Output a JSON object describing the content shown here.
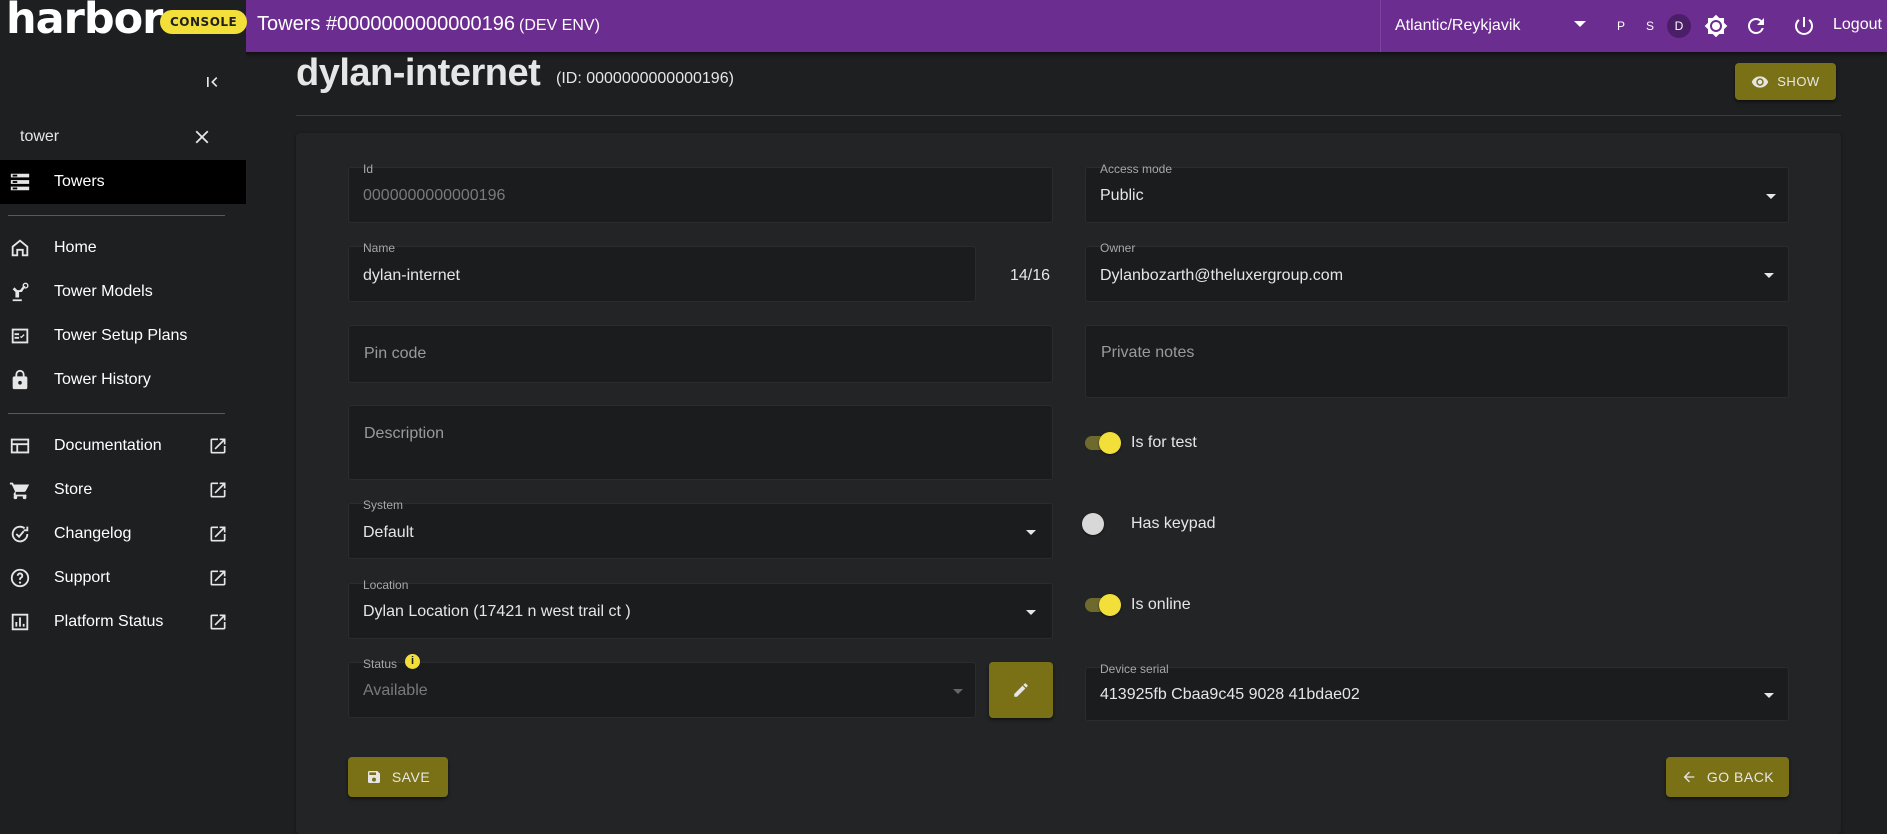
{
  "brand": {
    "name": "harbor",
    "badge": "CONSOLE"
  },
  "topbar": {
    "title": "Towers #0000000000000196",
    "env_label": "(DEV ENV)",
    "timezone": "Atlantic/Reykjavik",
    "env_chips": [
      "P",
      "S",
      "D"
    ],
    "active_env": "D",
    "logout_label": "Logout"
  },
  "sidebar": {
    "search_value": "tower",
    "active_item": {
      "label": "Towers",
      "icon": "towers-icon"
    },
    "items": [
      {
        "label": "Home",
        "icon": "home-icon"
      },
      {
        "label": "Tower Models",
        "icon": "robot-arm-icon"
      },
      {
        "label": "Tower Setup Plans",
        "icon": "checklist-icon"
      },
      {
        "label": "Tower History",
        "icon": "lock-icon"
      }
    ],
    "external_items": [
      {
        "label": "Documentation",
        "icon": "layout-icon"
      },
      {
        "label": "Store",
        "icon": "cart-icon"
      },
      {
        "label": "Changelog",
        "icon": "changelog-icon"
      },
      {
        "label": "Support",
        "icon": "help-icon"
      },
      {
        "label": "Platform Status",
        "icon": "status-chart-icon"
      }
    ]
  },
  "page": {
    "title": "dylan-internet",
    "subtitle": "(ID: 0000000000000196)",
    "show_label": "SHOW"
  },
  "form": {
    "id": {
      "label": "Id",
      "value": "0000000000000196"
    },
    "access_mode": {
      "label": "Access mode",
      "value": "Public"
    },
    "name": {
      "label": "Name",
      "value": "dylan-internet",
      "counter": "14/16"
    },
    "owner": {
      "label": "Owner",
      "value": "Dylanbozarth@theluxergroup.com"
    },
    "pin_code": {
      "placeholder": "Pin code"
    },
    "private_notes": {
      "placeholder": "Private notes"
    },
    "description": {
      "placeholder": "Description"
    },
    "is_for_test": {
      "label": "Is for test",
      "checked": true
    },
    "has_keypad": {
      "label": "Has keypad",
      "checked": false
    },
    "is_online": {
      "label": "Is online",
      "checked": true
    },
    "system": {
      "label": "System",
      "value": "Default"
    },
    "location": {
      "label": "Location",
      "value": "Dylan Location (17421 n west trail ct )"
    },
    "status": {
      "label": "Status",
      "value": "Available"
    },
    "device_serial": {
      "label": "Device serial",
      "value": "413925fb Cbaa9c45 9028 41bdae02"
    },
    "save_label": "SAVE",
    "back_label": "GO BACK"
  },
  "colors": {
    "topbar": "#6c2d91",
    "accent": "#f2df3a",
    "button": "#7a7117",
    "background": "#1e1f21"
  }
}
